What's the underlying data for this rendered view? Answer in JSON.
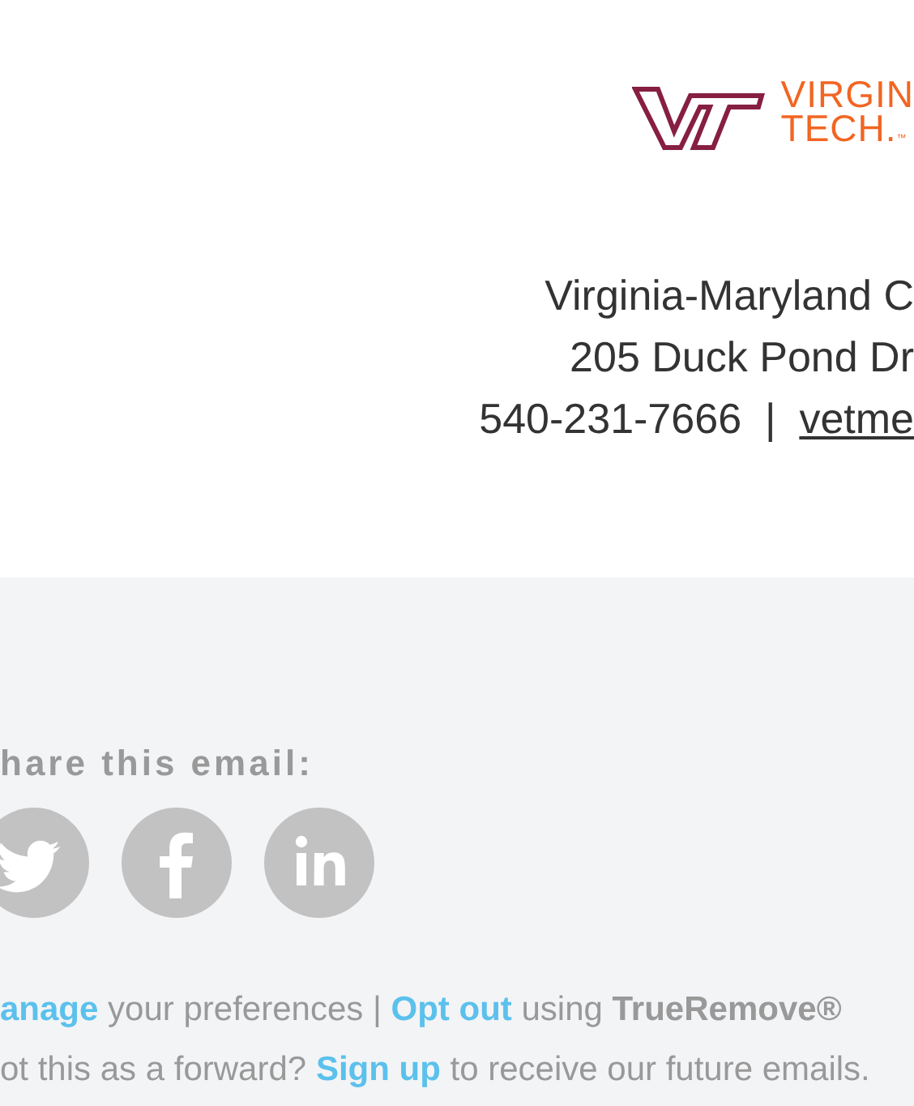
{
  "logo": {
    "line_1": "VIRGIN",
    "line_2": "TECH.",
    "trademark": "™"
  },
  "address": {
    "lines": [
      "Virginia-Maryland C",
      "205 Duck Pond Dr"
    ],
    "phone": "540-231-7666  |  ",
    "link": "vetme"
  },
  "share": {
    "heading": "hare this email:",
    "icons": [
      {
        "kind": "twitter"
      },
      {
        "kind": "facebook"
      },
      {
        "kind": "linkedin"
      }
    ]
  },
  "footer_lines": [
    [
      {
        "kind": "link",
        "text": "anage"
      },
      {
        "kind": "text",
        "text": " your preferences | "
      },
      {
        "kind": "link",
        "text": "Opt out"
      },
      {
        "kind": "text",
        "text": " using "
      },
      {
        "kind": "brand",
        "text": "TrueRemove®"
      }
    ],
    [
      {
        "kind": "text",
        "text": "ot this as a forward? "
      },
      {
        "kind": "link",
        "text": "Sign up"
      },
      {
        "kind": "text",
        "text": " to receive our future emails."
      }
    ]
  ]
}
